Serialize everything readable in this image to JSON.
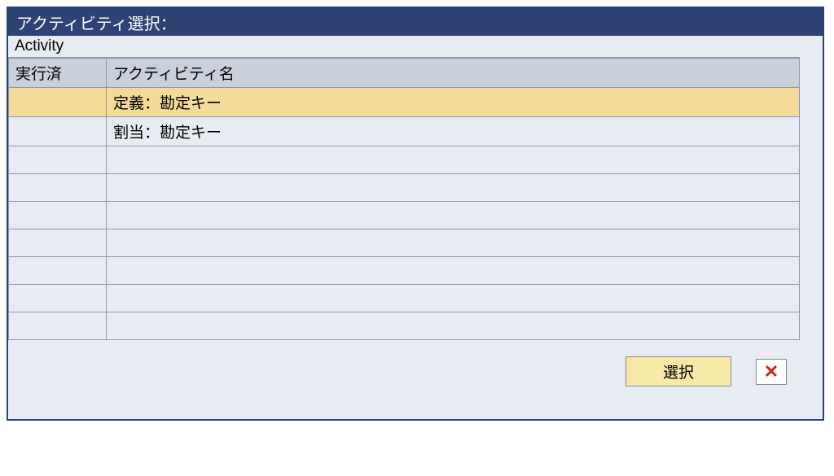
{
  "dialog": {
    "title": "アクティビティ選択：",
    "subtitle": "Activity"
  },
  "table": {
    "headers": {
      "executed": "実行済",
      "activityName": "アクティビティ名"
    },
    "rows": [
      {
        "executed": "",
        "name": "定義：勘定キー",
        "selected": true
      },
      {
        "executed": "",
        "name": "割当：勘定キー",
        "selected": false
      },
      {
        "executed": "",
        "name": "",
        "selected": false
      },
      {
        "executed": "",
        "name": "",
        "selected": false
      },
      {
        "executed": "",
        "name": "",
        "selected": false
      },
      {
        "executed": "",
        "name": "",
        "selected": false
      },
      {
        "executed": "",
        "name": "",
        "selected": false
      },
      {
        "executed": "",
        "name": "",
        "selected": false
      },
      {
        "executed": "",
        "name": "",
        "selected": false
      }
    ]
  },
  "buttons": {
    "select": "選択"
  }
}
